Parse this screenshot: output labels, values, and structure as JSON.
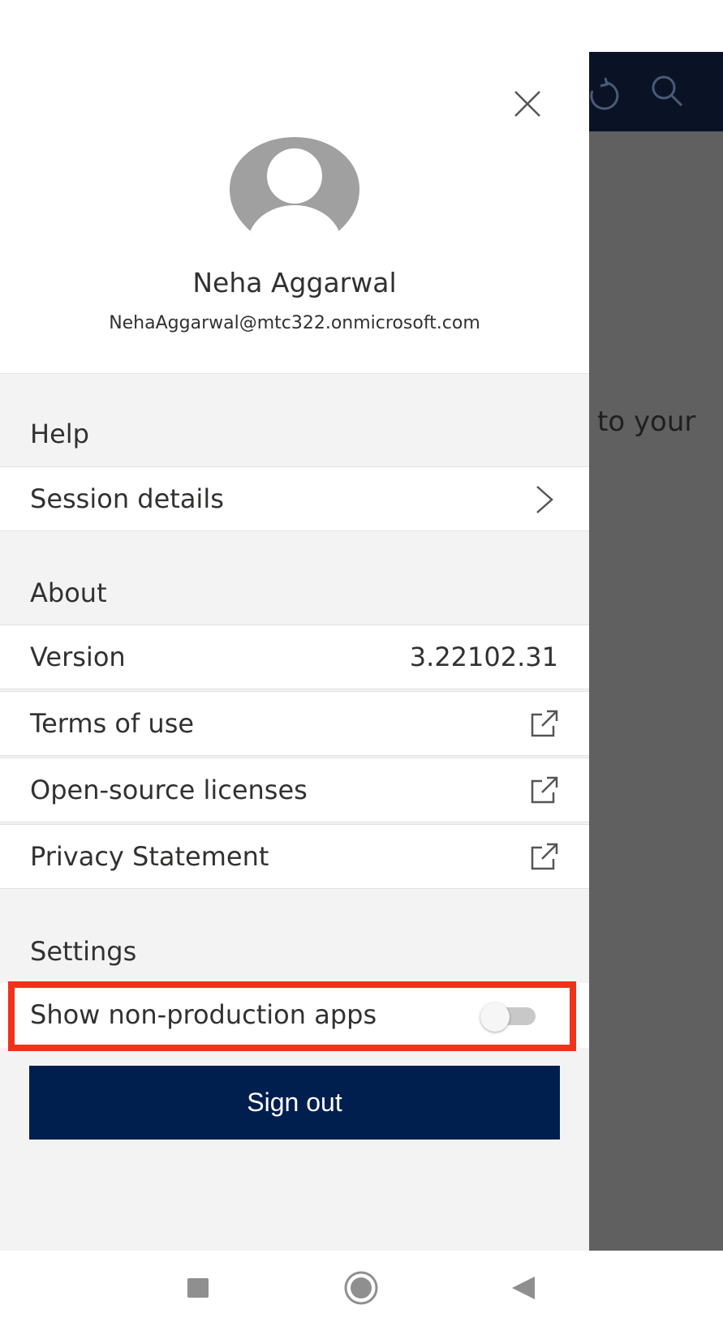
{
  "background_app": {
    "partial_text": "to your",
    "header_icons": [
      "refresh-icon",
      "search-icon"
    ]
  },
  "drawer": {
    "profile": {
      "name": "Neha Aggarwal",
      "email": "NehaAggarwal@mtc322.onmicrosoft.com",
      "close_icon": "close-icon"
    },
    "sections": {
      "help": {
        "title": "Help",
        "items": [
          {
            "label": "Session details",
            "icon": "chevron-right-icon"
          }
        ]
      },
      "about": {
        "title": "About",
        "version_label": "Version",
        "version_value": "3.22102.31",
        "links": [
          {
            "label": "Terms of use",
            "icon": "external-link-icon"
          },
          {
            "label": "Open-source licenses",
            "icon": "external-link-icon"
          },
          {
            "label": "Privacy Statement",
            "icon": "external-link-icon"
          }
        ]
      },
      "settings": {
        "title": "Settings",
        "toggle_label": "Show non-production apps",
        "toggle_on": false
      }
    },
    "signout_label": "Sign out"
  },
  "colors": {
    "signout_bg": "#001e4e",
    "highlight_border": "#f0321a",
    "overlay": "#606060",
    "app_header": "#0a1226"
  },
  "navbar": {
    "buttons": [
      "recents-icon",
      "home-icon",
      "back-icon"
    ]
  }
}
